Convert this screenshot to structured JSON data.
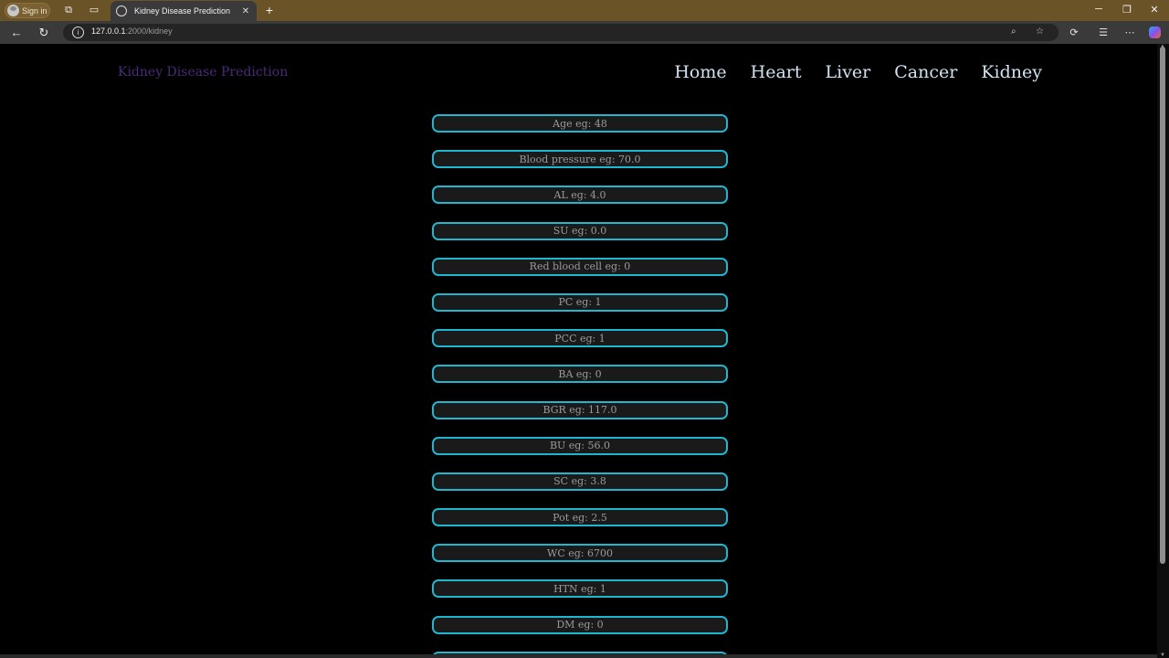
{
  "browser": {
    "signin_label": "Sign in",
    "tab_title": "Kidney Disease Prediction",
    "url_host": "127.0.0.1",
    "url_rest": ":2000/kidney"
  },
  "page": {
    "brand": "Kidney Disease Prediction",
    "nav": [
      "Home",
      "Heart",
      "Liver",
      "Cancer",
      "Kidney"
    ],
    "fields": [
      "Age eg: 48",
      "Blood pressure eg: 70.0",
      "AL eg: 4.0",
      "SU eg: 0.0",
      "Red blood cell eg: 0",
      "PC eg: 1",
      "PCC eg: 1",
      "BA eg: 0",
      "BGR eg: 117.0",
      "BU eg: 56.0",
      "SC eg: 3.8",
      "Pot eg: 2.5",
      "WC eg: 6700",
      "HTN eg: 1",
      "DM eg: 0",
      ""
    ]
  },
  "colors": {
    "input_border": "#1fb6cf",
    "brand": "#4a2a7a",
    "nav_link": "#cfe3f2",
    "titlebar": "#6b5328"
  }
}
